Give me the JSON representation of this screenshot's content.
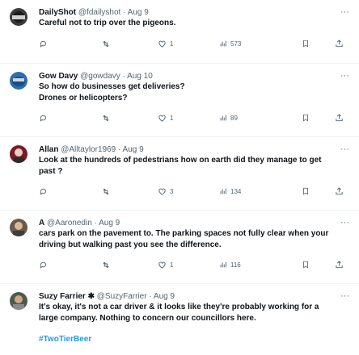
{
  "posts": [
    {
      "name": "DailyShot",
      "handle": "@fdailyshot",
      "date": "· Aug 9",
      "lines": [
        "Careful not to trip over the pigeons."
      ],
      "reposts": "",
      "likes": "1",
      "views": "573"
    },
    {
      "name": "Gow Davy",
      "handle": "@gowdavy",
      "date": "· Aug 10",
      "lines": [
        "So how do businesses get deliveries?",
        "Drones or helicopters?"
      ],
      "reposts": "",
      "likes": "1",
      "views": "89"
    },
    {
      "name": "Allan",
      "handle": "@Alltaylor1969",
      "date": "· Aug 9",
      "lines": [
        "Look at the hundreds of pedestrians how on earth did they manage to get",
        "past ?"
      ],
      "reposts": "",
      "likes": "3",
      "views": "134"
    },
    {
      "name": "A",
      "handle": "@Aaronedin",
      "date": "· Aug 9",
      "lines": [
        "cars park on the pavement to. The parking spaces not fully clear when your",
        "driving but walking past you see the difference."
      ],
      "reposts": "",
      "likes": "1",
      "views": "116"
    },
    {
      "name": "Suzy Farrier ✱",
      "handle": "@SuzyFarrier",
      "date": "· Aug 9",
      "lines": [
        "It's okay, it's not a car driver & it looks like they're probably working for a",
        "large company. Nothing to concern our councillors here."
      ],
      "hashtag": "#TwoTierBeer"
    }
  ],
  "icons": {
    "more": "more-icon",
    "reply": "reply-icon",
    "repost": "repost-icon",
    "like": "like-icon",
    "views": "views-icon",
    "bookmark": "bookmark-icon",
    "share": "share-icon"
  },
  "more_glyph": "···",
  "colors": {
    "text": "#0f1419",
    "muted": "#536471",
    "link": "#1d9bf0"
  }
}
